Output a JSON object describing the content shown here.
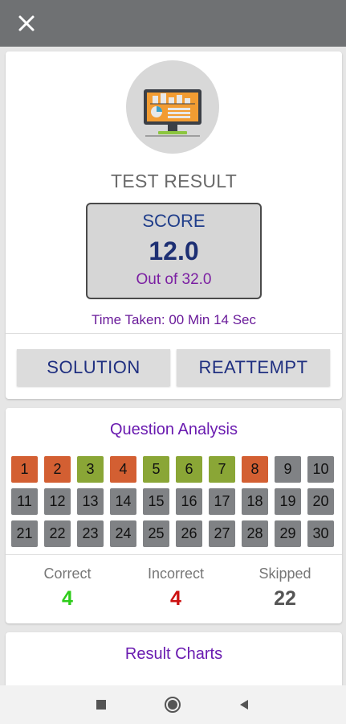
{
  "header": {
    "close_icon": "close-icon"
  },
  "result": {
    "title": "TEST RESULT",
    "score_label": "SCORE",
    "score_value": "12.0",
    "score_out_of": "Out of 32.0",
    "time_taken": "Time Taken: 00 Min 14 Sec"
  },
  "actions": {
    "solution_label": "SOLUTION",
    "reattempt_label": "REATTEMPT"
  },
  "analysis": {
    "title": "Question Analysis",
    "questions": [
      {
        "n": "1",
        "status": "incorrect"
      },
      {
        "n": "2",
        "status": "incorrect"
      },
      {
        "n": "3",
        "status": "correct"
      },
      {
        "n": "4",
        "status": "incorrect"
      },
      {
        "n": "5",
        "status": "correct"
      },
      {
        "n": "6",
        "status": "correct"
      },
      {
        "n": "7",
        "status": "correct"
      },
      {
        "n": "8",
        "status": "incorrect"
      },
      {
        "n": "9",
        "status": "skipped"
      },
      {
        "n": "10",
        "status": "skipped"
      },
      {
        "n": "11",
        "status": "skipped"
      },
      {
        "n": "12",
        "status": "skipped"
      },
      {
        "n": "13",
        "status": "skipped"
      },
      {
        "n": "14",
        "status": "skipped"
      },
      {
        "n": "15",
        "status": "skipped"
      },
      {
        "n": "16",
        "status": "skipped"
      },
      {
        "n": "17",
        "status": "skipped"
      },
      {
        "n": "18",
        "status": "skipped"
      },
      {
        "n": "19",
        "status": "skipped"
      },
      {
        "n": "20",
        "status": "skipped"
      },
      {
        "n": "21",
        "status": "skipped"
      },
      {
        "n": "22",
        "status": "skipped"
      },
      {
        "n": "23",
        "status": "skipped"
      },
      {
        "n": "24",
        "status": "skipped"
      },
      {
        "n": "25",
        "status": "skipped"
      },
      {
        "n": "26",
        "status": "skipped"
      },
      {
        "n": "27",
        "status": "skipped"
      },
      {
        "n": "28",
        "status": "skipped"
      },
      {
        "n": "29",
        "status": "skipped"
      },
      {
        "n": "30",
        "status": "skipped"
      }
    ],
    "stats": {
      "correct_label": "Correct",
      "correct_value": "4",
      "incorrect_label": "Incorrect",
      "incorrect_value": "4",
      "skipped_label": "Skipped",
      "skipped_value": "22"
    }
  },
  "charts": {
    "title": "Result Charts"
  },
  "colors": {
    "correct": "#8aa636",
    "incorrect": "#d35f32",
    "skipped": "#808285",
    "correct_text": "#2ecc1a",
    "incorrect_text": "#cc1111",
    "skipped_text": "#555555",
    "topbar": "#6f7173",
    "accent_purple": "#6a1bb0",
    "accent_navy": "#1f2f80"
  },
  "navbar": {
    "icons": [
      "recent-apps-icon",
      "home-icon",
      "back-icon"
    ]
  }
}
